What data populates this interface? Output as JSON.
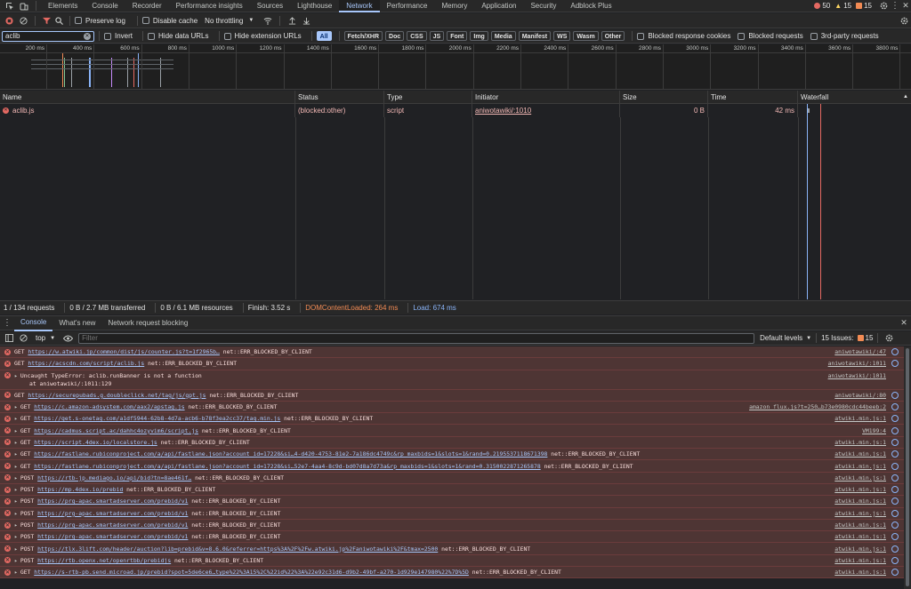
{
  "tabs": {
    "items": [
      "Elements",
      "Console",
      "Recorder",
      "Performance insights",
      "Sources",
      "Lighthouse",
      "Network",
      "Performance",
      "Memory",
      "Application",
      "Security",
      "Adblock Plus"
    ],
    "active": "Network",
    "errors": "50",
    "warnings": "15",
    "issues": "15"
  },
  "toolbar1": {
    "preserve_log": "Preserve log",
    "disable_cache": "Disable cache",
    "throttling": "No throttling"
  },
  "toolbar2": {
    "filter_value": "aclib",
    "invert": "Invert",
    "hide_data_urls": "Hide data URLs",
    "hide_extension_urls": "Hide extension URLs",
    "types": [
      "All",
      "Fetch/XHR",
      "Doc",
      "CSS",
      "JS",
      "Font",
      "Img",
      "Media",
      "Manifest",
      "WS",
      "Wasm",
      "Other"
    ],
    "blocked_cookies": "Blocked response cookies",
    "blocked_requests": "Blocked requests",
    "third_party": "3rd-party requests"
  },
  "overview": {
    "ticks": [
      "200 ms",
      "400 ms",
      "600 ms",
      "800 ms",
      "1000 ms",
      "1200 ms",
      "1400 ms",
      "1600 ms",
      "1800 ms",
      "2000 ms",
      "2200 ms",
      "2400 ms",
      "2600 ms",
      "2800 ms",
      "3000 ms",
      "3200 ms",
      "3400 ms",
      "3600 ms",
      "3800 ms"
    ]
  },
  "table": {
    "headers": {
      "name": "Name",
      "status": "Status",
      "type": "Type",
      "initiator": "Initiator",
      "size": "Size",
      "time": "Time",
      "waterfall": "Waterfall"
    },
    "rows": [
      {
        "name": "aclib.js",
        "status": "(blocked:other)",
        "type": "script",
        "initiator": "aniwotawiki/:1010",
        "size": "0 B",
        "time": "42 ms"
      }
    ]
  },
  "status": {
    "requests": "1 / 134 requests",
    "transferred": "0 B / 2.7 MB transferred",
    "resources": "0 B / 6.1 MB resources",
    "finish": "Finish: 3.52 s",
    "dcl": "DOMContentLoaded: 264 ms",
    "load": "Load: 674 ms"
  },
  "drawer": {
    "tabs": [
      "Console",
      "What's new",
      "Network request blocking"
    ],
    "context": "top",
    "filter_placeholder": "Filter",
    "levels": "Default levels",
    "issues": "15 Issues:",
    "issues_count": "15"
  },
  "console": [
    {
      "arrow": "",
      "method": "GET",
      "url": "https://w.atwiki.jp/common/dist/js/counter.js?t=1f2965b…",
      "msg": "net::ERR_BLOCKED_BY_CLIENT",
      "src": "aniwotawiki/:47"
    },
    {
      "arrow": "",
      "method": "GET",
      "url": "https://acscdn.com/script/aclib.js",
      "msg": "net::ERR_BLOCKED_BY_CLIENT",
      "src": "aniwotawiki/:1011"
    },
    {
      "arrow": "▸",
      "method": "Uncaught TypeError: aclib.runBanner is not a function",
      "url": "",
      "msg": "",
      "src": "aniwotawiki/:1011",
      "line2": "at aniwotawiki/:1011:129",
      "tall": true
    },
    {
      "arrow": "",
      "method": "GET",
      "url": "https://securepubads.g.doubleclick.net/tag/js/gpt.js",
      "msg": "net::ERR_BLOCKED_BY_CLIENT",
      "src": "aniwotawiki/:80"
    },
    {
      "arrow": "▸",
      "method": "GET",
      "url": "https://c.amazon-adsystem.com/aax2/apstag.js",
      "msg": "net::ERR_BLOCKED_BY_CLIENT",
      "src": "amazon_flux.js?t=250…b73e0980cdc44beeb:2"
    },
    {
      "arrow": "▸",
      "method": "GET",
      "url": "https://get.s-onetag.com/a1df5944-62b8-4d7a-acb6-b78f3ea2cc37/tag.min.js",
      "msg": "net::ERR_BLOCKED_BY_CLIENT",
      "src": "atwiki.min.js:1"
    },
    {
      "arrow": "▸",
      "method": "GET",
      "url": "https://cadmus.script.ac/dahhc4ozyvim6/script.js",
      "msg": "net::ERR_BLOCKED_BY_CLIENT",
      "src": "VM199:4"
    },
    {
      "arrow": "▸",
      "method": "GET",
      "url": "https://script.4dex.io/localstore.js",
      "msg": "net::ERR_BLOCKED_BY_CLIENT",
      "src": "atwiki.min.js:1"
    },
    {
      "arrow": "▸",
      "method": "GET",
      "url": "https://fastlane.rubiconproject.com/a/api/fastlane.json?account_id=17228&si…4-d420-4753-81e2-7a186dc4749c&rp_maxbids=1&slots=1&rand=0.2195537118671398",
      "msg": "net::ERR_BLOCKED_BY_CLIENT",
      "src": "atwiki.min.js:1"
    },
    {
      "arrow": "▸",
      "method": "GET",
      "url": "https://fastlane.rubiconproject.com/a/api/fastlane.json?account_id=17228&si…52e7-4aa4-8c9d-bd07d8a7d73a&rp_maxbids=1&slots=1&rand=0.3150022871265878",
      "msg": "net::ERR_BLOCKED_BY_CLIENT",
      "src": "atwiki.min.js:1"
    },
    {
      "arrow": "▸",
      "method": "POST",
      "url": "https://rtb-jp.mediago.io/api/bid?tn=8ae461f…",
      "msg": "net::ERR_BLOCKED_BY_CLIENT",
      "src": "atwiki.min.js:1"
    },
    {
      "arrow": "▸",
      "method": "POST",
      "url": "https://mp.4dex.io/prebid",
      "msg": "net::ERR_BLOCKED_BY_CLIENT",
      "src": "atwiki.min.js:1"
    },
    {
      "arrow": "▸",
      "method": "POST",
      "url": "https://prg-apac.smartadserver.com/prebid/v1",
      "msg": "net::ERR_BLOCKED_BY_CLIENT",
      "src": "atwiki.min.js:1"
    },
    {
      "arrow": "▸",
      "method": "POST",
      "url": "https://prg-apac.smartadserver.com/prebid/v1",
      "msg": "net::ERR_BLOCKED_BY_CLIENT",
      "src": "atwiki.min.js:1"
    },
    {
      "arrow": "▸",
      "method": "POST",
      "url": "https://prg-apac.smartadserver.com/prebid/v1",
      "msg": "net::ERR_BLOCKED_BY_CLIENT",
      "src": "atwiki.min.js:1"
    },
    {
      "arrow": "▸",
      "method": "POST",
      "url": "https://prg-apac.smartadserver.com/prebid/v1",
      "msg": "net::ERR_BLOCKED_BY_CLIENT",
      "src": "atwiki.min.js:1"
    },
    {
      "arrow": "▸",
      "method": "POST",
      "url": "https://tlx.3lift.com/header/auction?lib=prebid&v=8.6.0&referrer=https%3A%2F%2Fw.atwiki.jp%2Faniwotawiki%2F&tmax=2500",
      "msg": "net::ERR_BLOCKED_BY_CLIENT",
      "src": "atwiki.min.js:1"
    },
    {
      "arrow": "▸",
      "method": "POST",
      "url": "https://rtb.openx.net/openrtbb/prebidjs",
      "msg": "net::ERR_BLOCKED_BY_CLIENT",
      "src": "atwiki.min.js:1"
    },
    {
      "arrow": "▸",
      "method": "GET",
      "url": "https://s-rtb-pb.send.microad.jp/prebid?spot=5de6ce6…type%22%3A15%2C%22id%22%3A%22e92c31d6-d9b2-49bf-a270-1d929e147980%22%7D%5D",
      "msg": "net::ERR_BLOCKED_BY_CLIENT",
      "src": "atwiki.min.js:1"
    }
  ]
}
